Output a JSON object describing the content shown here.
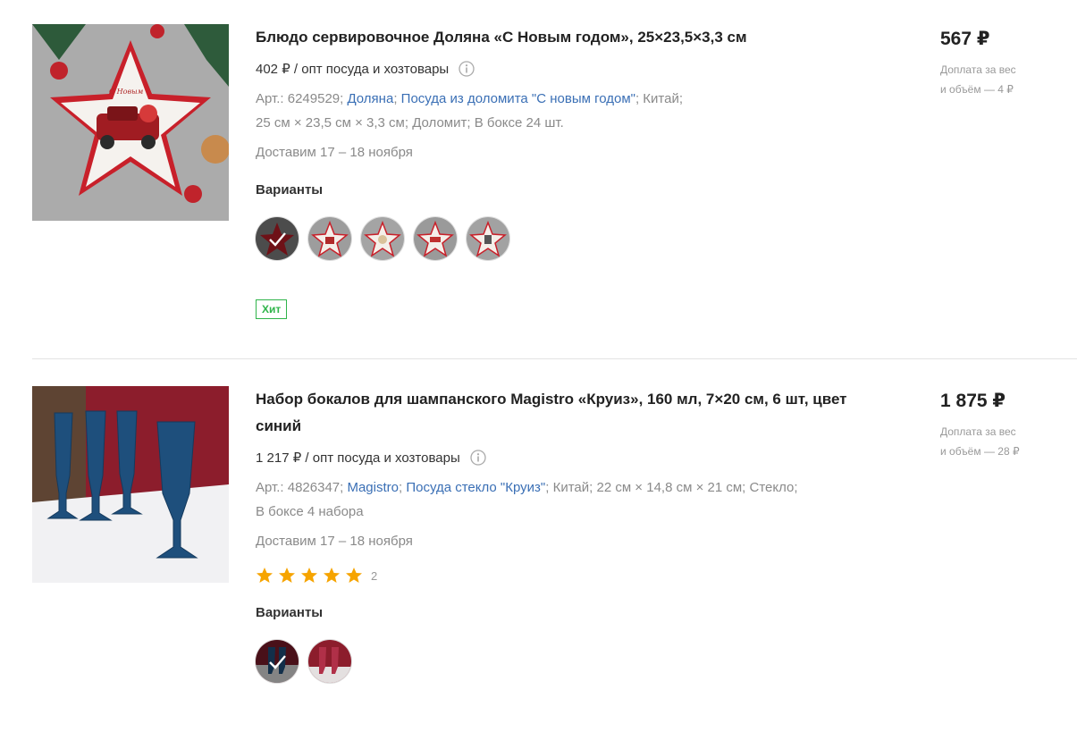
{
  "products": [
    {
      "title": "Блюдо сервировочное Доляна «С Новым годом», 25×23,5×3,3 см",
      "wholesale_price": "402 ₽ / опт посуда и хозтовары",
      "art_label": "Арт.: 6249529;",
      "brand_link": "Доляна",
      "series_link": "Посуда из доломита \"С новым годом\"",
      "specs_after_series": "; Китай;",
      "specs_line2": "25 см × 23,5 см × 3,3 см; Доломит; В боксе 24 шт.",
      "delivery": "Доставим 17 – 18 ноября",
      "variants_label": "Варианты",
      "badge": "Хит",
      "price": "567 ₽",
      "surcharge_line1": "Доплата за вес",
      "surcharge_line2": "и объём — 4 ₽"
    },
    {
      "title": "Набор бокалов для шампанского Magistro «Круиз», 160 мл, 7×20 см, 6 шт, цвет синий",
      "wholesale_price": "1 217 ₽ / опт посуда и хозтовары",
      "art_label": "Арт.: 4826347;",
      "brand_link": "Magistro",
      "series_link": "Посуда стекло \"Круиз\"",
      "specs_after_series": "; Китай; 22 см × 14,8 см × 21 см; Стекло;",
      "specs_line2": "В боксе 4 набора",
      "delivery": "Доставим 17 – 18 ноября",
      "rating": 5,
      "review_count": "2",
      "variants_label": "Варианты",
      "price": "1 875 ₽",
      "surcharge_line1": "Доплата за вес",
      "surcharge_line2": "и объём — 28 ₽"
    }
  ],
  "colors": {
    "link": "#3a6fb5",
    "badge_green": "#2fb44a",
    "star": "#f6a400",
    "muted": "#8a8a8a"
  },
  "icons": [
    "info-icon",
    "star-icon",
    "check-icon"
  ]
}
